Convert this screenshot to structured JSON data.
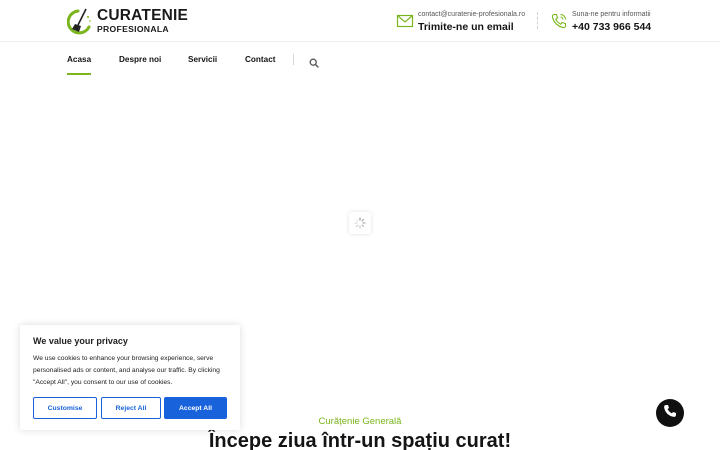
{
  "brand": {
    "line1": "CURATENIE",
    "line2": "PROFESIONALA",
    "accent_color": "#7ab51d"
  },
  "contact": {
    "email": {
      "icon": "envelope-icon",
      "small": "contact@curatenie-profesionala.ro",
      "big": "Trimite-ne un email"
    },
    "phone": {
      "icon": "phone-icon",
      "small": "Suna-ne pentru informatii",
      "big": "+40 733 966 544"
    }
  },
  "nav": {
    "items": [
      {
        "label": "Acasa",
        "active": true
      },
      {
        "label": "Despre noi",
        "active": false
      },
      {
        "label": "Servicii",
        "active": false
      },
      {
        "label": "Contact",
        "active": false
      }
    ],
    "search_icon": "search-icon"
  },
  "hero": {
    "subtitle": "Curățenie Generală",
    "title": "Începe ziua într-un spațiu curat!"
  },
  "cookie": {
    "title": "We value your privacy",
    "body": "We use cookies to enhance your browsing experience, serve personalised ads or content, and analyse our traffic. By clicking \"Accept All\", you consent to our use of cookies.",
    "customise": "Customise",
    "reject": "Reject All",
    "accept": "Accept All",
    "button_color": "#1863dc"
  },
  "floating": {
    "call_icon": "phone-icon"
  }
}
